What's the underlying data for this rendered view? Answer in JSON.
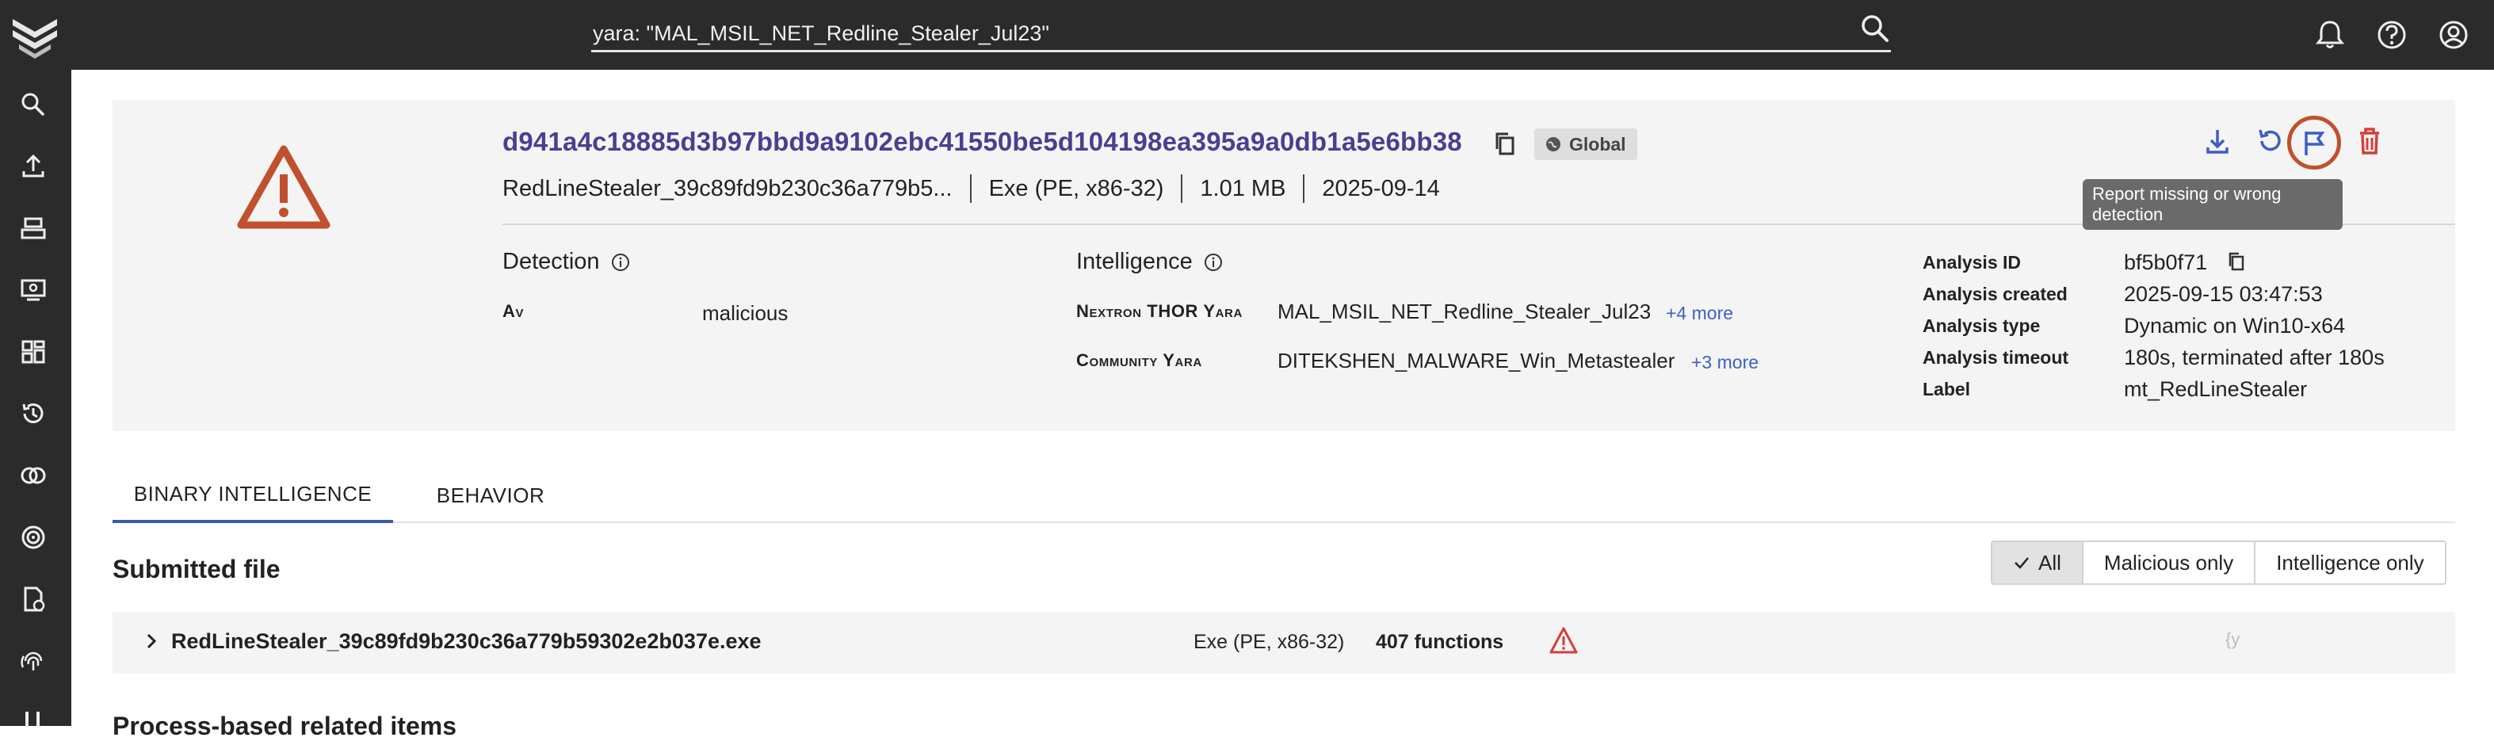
{
  "search": {
    "value": "yara: \"MAL_MSIL_NET_Redline_Stealer_Jul23\""
  },
  "sample": {
    "hash": "d941a4c18885d3b97bbd9a9102ebc41550be5d104198ea395a9a0db1a5e6bb38",
    "badge": "Global",
    "filename_short": "RedLineStealer_39c89fd9b230c36a779b5...",
    "type": "Exe (PE, x86-32)",
    "size": "1.01 MB",
    "date": "2025-09-14"
  },
  "detection": {
    "title": "Detection",
    "rows": [
      {
        "label": "Av",
        "value": "malicious"
      }
    ]
  },
  "intelligence": {
    "title": "Intelligence",
    "rows": [
      {
        "label": "Nextron THOR Yara",
        "value": "MAL_MSIL_NET_Redline_Stealer_Jul23",
        "more": "+4 more"
      },
      {
        "label": "Community Yara",
        "value": "DITEKSHEN_MALWARE_Win_Metastealer",
        "more": "+3 more"
      }
    ]
  },
  "analysis": {
    "rows": [
      {
        "label": "Analysis ID",
        "value": "bf5b0f71"
      },
      {
        "label": "Analysis created",
        "value": "2025-09-15 03:47:53"
      },
      {
        "label": "Analysis type",
        "value": "Dynamic on Win10-x64"
      },
      {
        "label": "Analysis timeout",
        "value": "180s, terminated after 180s"
      },
      {
        "label": "Label",
        "value": "mt_RedLineStealer"
      }
    ]
  },
  "tooltip": {
    "text": "Report missing or wrong detection"
  },
  "tabs": [
    {
      "label": "BINARY INTELLIGENCE"
    },
    {
      "label": "BEHAVIOR"
    }
  ],
  "submitted": {
    "title": "Submitted file",
    "filters": [
      {
        "label": "All"
      },
      {
        "label": "Malicious only"
      },
      {
        "label": "Intelligence only"
      }
    ],
    "file": {
      "name": "RedLineStealer_39c89fd9b230c36a779b59302e2b037e.exe",
      "type": "Exe (PE, x86-32)",
      "functions": "407 functions",
      "glyph": "{y"
    }
  },
  "next_section": {
    "title": "Process-based related items"
  },
  "colors": {
    "accent": "#4a3f8f",
    "warning": "#c0502e",
    "danger": "#d43f3a",
    "link": "#3d5fc4",
    "topbar": "#2b2b2b"
  }
}
